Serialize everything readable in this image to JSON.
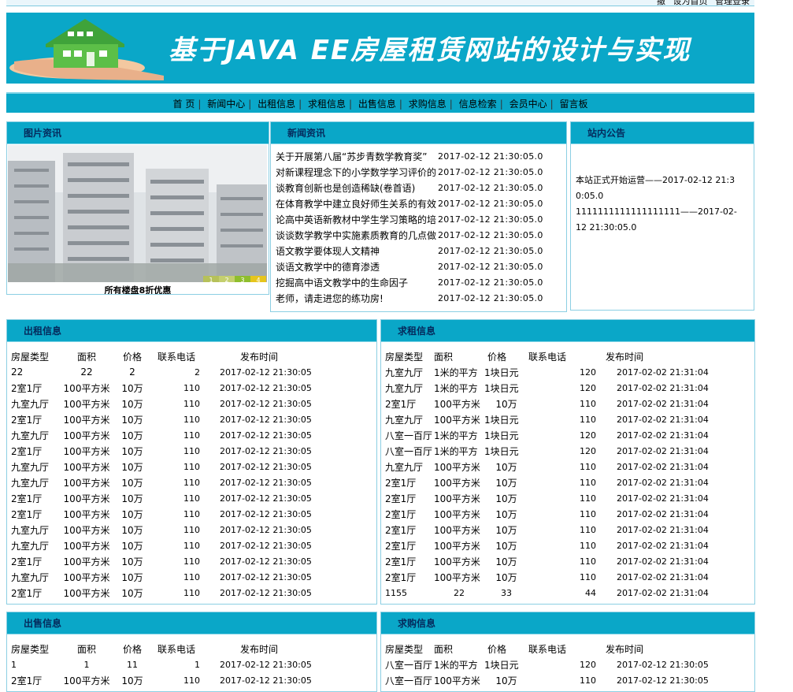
{
  "topbar": {
    "links": [
      "撤",
      "设为首页",
      "管理登录"
    ]
  },
  "banner": {
    "title": "基于JAVA EE房屋租赁网站的设计与实现"
  },
  "nav": {
    "items": [
      "首 页",
      "新闻中心",
      "出租信息",
      "求租信息",
      "出售信息",
      "求购信息",
      "信息检索",
      "会员中心",
      "留言板"
    ]
  },
  "photo_news": {
    "heading": "图片资讯",
    "caption": "所有楼盘8折优惠",
    "pages": [
      "1",
      "2",
      "3",
      "4"
    ]
  },
  "news": {
    "heading": "新闻资讯",
    "items": [
      {
        "title": "关于开展第八届“苏步青数学教育奖”",
        "time": "2017-02-12 21:30:05.0"
      },
      {
        "title": "对新课程理念下的小学数学学习评价的",
        "time": "2017-02-12 21:30:05.0"
      },
      {
        "title": "谈教育创新也是创造稀缺(卷首语)",
        "time": "2017-02-12 21:30:05.0"
      },
      {
        "title": "在体育教学中建立良好师生关系的有效",
        "time": "2017-02-12 21:30:05.0"
      },
      {
        "title": "论高中英语新教材中学生学习策略的培",
        "time": "2017-02-12 21:30:05.0"
      },
      {
        "title": "谈谈数学教学中实施素质教育的几点做",
        "time": "2017-02-12 21:30:05.0"
      },
      {
        "title": "语文教学要体现人文精神",
        "time": "2017-02-12 21:30:05.0"
      },
      {
        "title": "谈语文教学中的德育渗透",
        "time": "2017-02-12 21:30:05.0"
      },
      {
        "title": "挖掘高中语文教学中的生命因子",
        "time": "2017-02-12 21:30:05.0"
      },
      {
        "title": "老师，请走进您的练功房!",
        "time": "2017-02-12 21:30:05.0"
      }
    ]
  },
  "notice": {
    "heading": "站内公告",
    "items": [
      "本站正式开始运营——2017-02-12 21:30:05.0",
      "1111111111111111111——2017-02-12 21:30:05.0"
    ]
  },
  "rent_out": {
    "heading": "出租信息",
    "columns": [
      "房屋类型",
      "面积",
      "价格",
      "联系电话",
      "发布时间"
    ],
    "rows": [
      [
        "22",
        "22",
        "2",
        "2",
        "2017-02-12 21:30:05"
      ],
      [
        "2室1厅",
        "100平方米",
        "10万",
        "110",
        "2017-02-12 21:30:05"
      ],
      [
        "九室九厅",
        "100平方米",
        "10万",
        "110",
        "2017-02-12 21:30:05"
      ],
      [
        "2室1厅",
        "100平方米",
        "10万",
        "110",
        "2017-02-12 21:30:05"
      ],
      [
        "九室九厅",
        "100平方米",
        "10万",
        "110",
        "2017-02-12 21:30:05"
      ],
      [
        "2室1厅",
        "100平方米",
        "10万",
        "110",
        "2017-02-12 21:30:05"
      ],
      [
        "九室九厅",
        "100平方米",
        "10万",
        "110",
        "2017-02-12 21:30:05"
      ],
      [
        "九室九厅",
        "100平方米",
        "10万",
        "110",
        "2017-02-12 21:30:05"
      ],
      [
        "2室1厅",
        "100平方米",
        "10万",
        "110",
        "2017-02-12 21:30:05"
      ],
      [
        "2室1厅",
        "100平方米",
        "10万",
        "110",
        "2017-02-12 21:30:05"
      ],
      [
        "九室九厅",
        "100平方米",
        "10万",
        "110",
        "2017-02-12 21:30:05"
      ],
      [
        "九室九厅",
        "100平方米",
        "10万",
        "110",
        "2017-02-12 21:30:05"
      ],
      [
        "2室1厅",
        "100平方米",
        "10万",
        "110",
        "2017-02-12 21:30:05"
      ],
      [
        "九室九厅",
        "100平方米",
        "10万",
        "110",
        "2017-02-12 21:30:05"
      ],
      [
        "2室1厅",
        "100平方米",
        "10万",
        "110",
        "2017-02-12 21:30:05"
      ]
    ]
  },
  "rent_wanted": {
    "heading": "求租信息",
    "columns": [
      "房屋类型",
      "面积",
      "价格",
      "联系电话",
      "发布时间"
    ],
    "rows": [
      [
        "九室九厅",
        "1米的平方",
        "1块日元",
        "120",
        "2017-02-02 21:31:04"
      ],
      [
        "九室九厅",
        "1米的平方",
        "1块日元",
        "120",
        "2017-02-02 21:31:04"
      ],
      [
        "2室1厅",
        "100平方米",
        "10万",
        "110",
        "2017-02-02 21:31:04"
      ],
      [
        "九室九厅",
        "100平方米",
        "1块日元",
        "110",
        "2017-02-02 21:31:04"
      ],
      [
        "八室一百厅",
        "1米的平方",
        "1块日元",
        "120",
        "2017-02-02 21:31:04"
      ],
      [
        "八室一百厅",
        "1米的平方",
        "1块日元",
        "120",
        "2017-02-02 21:31:04"
      ],
      [
        "九室九厅",
        "100平方米",
        "10万",
        "110",
        "2017-02-02 21:31:04"
      ],
      [
        "2室1厅",
        "100平方米",
        "10万",
        "110",
        "2017-02-02 21:31:04"
      ],
      [
        "2室1厅",
        "100平方米",
        "10万",
        "110",
        "2017-02-02 21:31:04"
      ],
      [
        "2室1厅",
        "100平方米",
        "10万",
        "110",
        "2017-02-02 21:31:04"
      ],
      [
        "2室1厅",
        "100平方米",
        "10万",
        "110",
        "2017-02-02 21:31:04"
      ],
      [
        "2室1厅",
        "100平方米",
        "10万",
        "110",
        "2017-02-02 21:31:04"
      ],
      [
        "2室1厅",
        "100平方米",
        "10万",
        "110",
        "2017-02-02 21:31:04"
      ],
      [
        "2室1厅",
        "100平方米",
        "10万",
        "110",
        "2017-02-02 21:31:04"
      ],
      [
        "1155",
        "22",
        "33",
        "44",
        "2017-02-02 21:31:04"
      ]
    ]
  },
  "for_sale": {
    "heading": "出售信息",
    "columns": [
      "房屋类型",
      "面积",
      "价格",
      "联系电话",
      "发布时间"
    ],
    "rows": [
      [
        "1",
        "1",
        "11",
        "1",
        "2017-02-12 21:30:05"
      ],
      [
        "2室1厅",
        "100平方米",
        "10万",
        "110",
        "2017-02-12 21:30:05"
      ]
    ]
  },
  "want_buy": {
    "heading": "求购信息",
    "columns": [
      "房屋类型",
      "面积",
      "价格",
      "联系电话",
      "发布时间"
    ],
    "rows": [
      [
        "八室一百厅",
        "1米的平方",
        "1块日元",
        "120",
        "2017-02-12 21:30:05"
      ],
      [
        "八室一百厅",
        "100平方米",
        "10万",
        "110",
        "2017-02-12 21:30:05"
      ]
    ]
  }
}
